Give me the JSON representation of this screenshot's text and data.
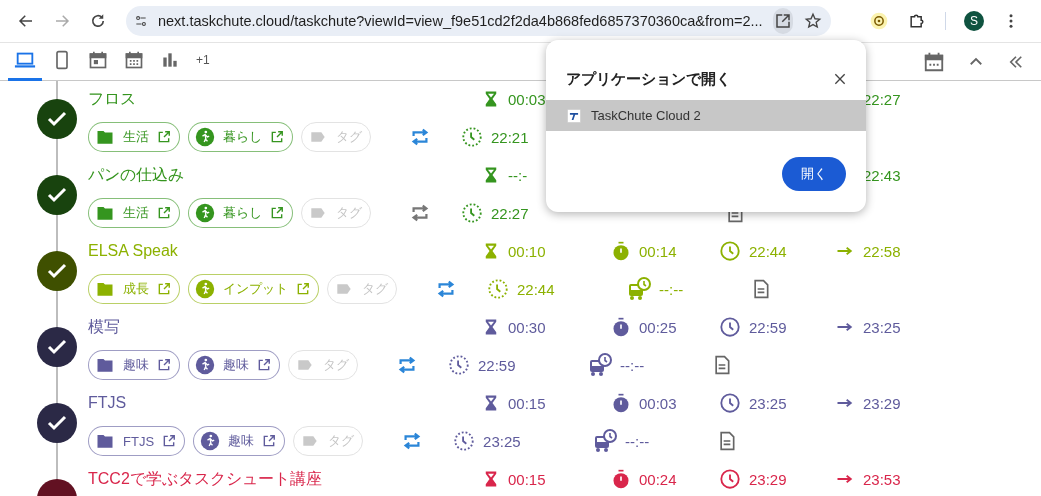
{
  "browser": {
    "url": "next.taskchute.cloud/taskchute?viewId=view_f9e51cd2f2da4b868fed6857370360ca&from=2...",
    "avatar": "S"
  },
  "view_tabs": [
    {
      "kind": "laptop",
      "selected": true
    },
    {
      "kind": "phone",
      "selected": false
    },
    {
      "kind": "day",
      "selected": false
    },
    {
      "kind": "month",
      "selected": false
    },
    {
      "kind": "chart",
      "selected": false
    },
    {
      "kind": "more",
      "label": "+1",
      "selected": false
    }
  ],
  "tasks": [
    {
      "title": "フロス",
      "color": "#35951f",
      "tags": [
        {
          "kind": "project",
          "label": "生活"
        },
        {
          "kind": "mode",
          "label": "暮らし"
        },
        {
          "kind": "tag",
          "label": "タグ"
        }
      ],
      "repeat_active": true,
      "estimate": "00:03",
      "end": "22:27",
      "scheduled": "22:21"
    },
    {
      "title": "パンの仕込み",
      "color": "#35951f",
      "tags": [
        {
          "kind": "project",
          "label": "生活"
        },
        {
          "kind": "mode",
          "label": "暮らし"
        },
        {
          "kind": "tag",
          "label": "タグ"
        }
      ],
      "repeat_active": false,
      "estimate": "--:-",
      "end": "22:43",
      "scheduled": "22:27",
      "note": true
    },
    {
      "title": "ELSA Speak",
      "color": "#8cb100",
      "tags": [
        {
          "kind": "project",
          "label": "成長"
        },
        {
          "kind": "mode",
          "label": "インプット"
        },
        {
          "kind": "tag",
          "label": "タグ"
        }
      ],
      "repeat_active": true,
      "estimate": "00:10",
      "actual": "00:14",
      "start": "22:44",
      "end": "22:58",
      "scheduled": "22:44",
      "bus": "--:--",
      "note": true
    },
    {
      "title": "模写",
      "color": "#5f5b9c",
      "tags": [
        {
          "kind": "project",
          "label": "趣味"
        },
        {
          "kind": "mode",
          "label": "趣味"
        },
        {
          "kind": "tag",
          "label": "タグ"
        }
      ],
      "repeat_active": true,
      "estimate": "00:30",
      "actual": "00:25",
      "start": "22:59",
      "end": "23:25",
      "scheduled": "22:59",
      "bus": "--:--",
      "note": true
    },
    {
      "title": "FTJS",
      "color": "#5f5b9c",
      "tags": [
        {
          "kind": "project",
          "label": "FTJS"
        },
        {
          "kind": "mode",
          "label": "趣味"
        },
        {
          "kind": "tag",
          "label": "タグ"
        }
      ],
      "repeat_active": true,
      "estimate": "00:15",
      "actual": "00:03",
      "start": "23:25",
      "end": "23:29",
      "scheduled": "23:25",
      "bus": "--:--",
      "note": true
    },
    {
      "title": "TCC2で学ぶタスクシュート講座",
      "color": "#d9264b",
      "estimate": "00:15",
      "actual": "00:24",
      "start": "23:29",
      "end": "23:53"
    }
  ],
  "dialog": {
    "title": "アプリケーションで開く",
    "app": "TaskChute Cloud 2",
    "button": "開く"
  }
}
